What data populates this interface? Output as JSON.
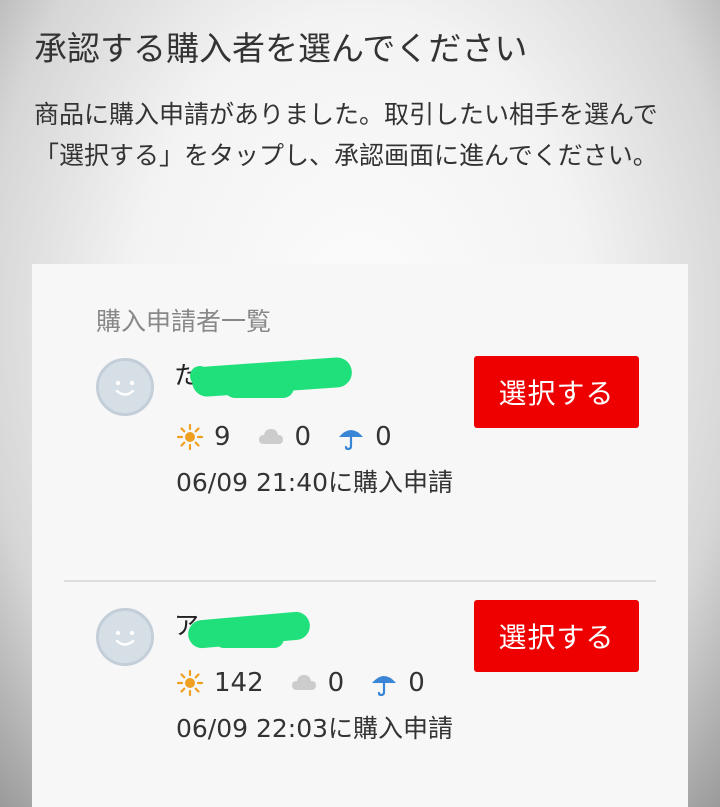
{
  "page": {
    "title": "承認する購入者を選んでください",
    "description": "商品に購入申請がありました。取引したい相手を選んで「選択する」をタップし、承認画面に進んでください。"
  },
  "applicants": {
    "section_title": "購入申請者一覧",
    "select_label": "選択する",
    "items": [
      {
        "name": "た",
        "ratings": {
          "good": "9",
          "normal": "0",
          "bad": "0"
        },
        "request_time": "06/09 21:40に購入申請"
      },
      {
        "name": "ア",
        "ratings": {
          "good": "142",
          "normal": "0",
          "bad": "0"
        },
        "request_time": "06/09 22:03に購入申請"
      }
    ]
  },
  "icons": {
    "good": "sun-icon",
    "normal": "cloud-icon",
    "bad": "umbrella-icon"
  },
  "colors": {
    "button": "#ee0000",
    "sun": "#f0a020",
    "cloud": "#cccccc",
    "umbrella": "#3a86d6",
    "redaction": "#1fe07a"
  }
}
